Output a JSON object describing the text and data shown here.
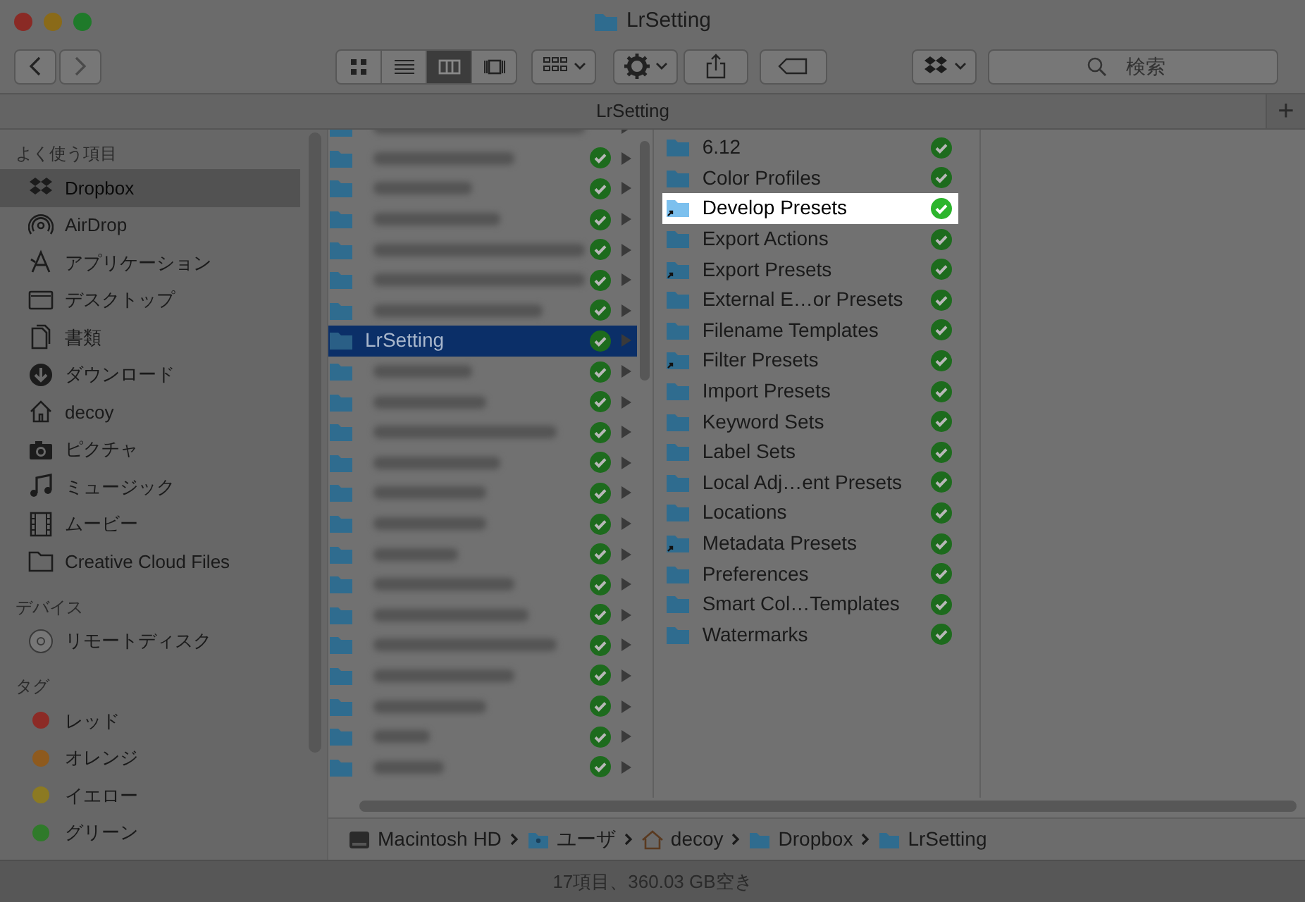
{
  "window": {
    "title": "LrSetting"
  },
  "toolbar": {
    "view_modes": [
      {
        "kind": "icons",
        "selected": false
      },
      {
        "kind": "list",
        "selected": false
      },
      {
        "kind": "columns",
        "selected": true
      },
      {
        "kind": "gallery",
        "selected": false
      }
    ],
    "search": {
      "placeholder": "検索"
    }
  },
  "tab_bar": {
    "tabs": [
      {
        "label": "LrSetting",
        "selected": true
      }
    ],
    "new_tab": "+"
  },
  "sidebar": {
    "sections": [
      {
        "title": "よく使う項目",
        "items": [
          {
            "label": "Dropbox",
            "kind": "dropbox",
            "selected": true
          },
          {
            "label": "AirDrop",
            "kind": "airdrop",
            "selected": false
          },
          {
            "label": "アプリケーション",
            "kind": "apps",
            "selected": false
          },
          {
            "label": "デスクトップ",
            "kind": "desktop",
            "selected": false
          },
          {
            "label": "書類",
            "kind": "documents",
            "selected": false
          },
          {
            "label": "ダウンロード",
            "kind": "downloads",
            "selected": false
          },
          {
            "label": "decoy",
            "kind": "home",
            "selected": false
          },
          {
            "label": "ピクチャ",
            "kind": "pictures",
            "selected": false
          },
          {
            "label": "ミュージック",
            "kind": "music",
            "selected": false
          },
          {
            "label": "ムービー",
            "kind": "movies",
            "selected": false
          },
          {
            "label": "Creative Cloud Files",
            "kind": "folder",
            "selected": false
          }
        ]
      },
      {
        "title": "デバイス",
        "items": [
          {
            "label": "リモートディスク",
            "kind": "disc",
            "selected": false
          }
        ]
      },
      {
        "title": "タグ",
        "items": [
          {
            "label": "レッド",
            "kind": "tag",
            "color": "#8c2b26",
            "selected": false
          },
          {
            "label": "オレンジ",
            "kind": "tag",
            "color": "#8e5a1e",
            "selected": false
          },
          {
            "label": "イエロー",
            "kind": "tag",
            "color": "#8c7a22",
            "selected": false
          },
          {
            "label": "グリーン",
            "kind": "tag",
            "color": "#2f7a2a",
            "selected": false
          }
        ]
      }
    ]
  },
  "columns": [
    {
      "rows": [
        {
          "kind": "blurred",
          "synced": false,
          "selected": false
        },
        {
          "kind": "blurred",
          "synced": true,
          "selected": false
        },
        {
          "kind": "blurred",
          "synced": true,
          "selected": false
        },
        {
          "kind": "blurred",
          "synced": true,
          "selected": false
        },
        {
          "kind": "blurred",
          "synced": true,
          "selected": false
        },
        {
          "kind": "blurred",
          "synced": true,
          "selected": false
        },
        {
          "kind": "blurred",
          "synced": true,
          "selected": false
        },
        {
          "kind": "folder",
          "label": "LrSetting",
          "synced": true,
          "selected": true
        },
        {
          "kind": "blurred",
          "synced": true,
          "selected": false
        },
        {
          "kind": "blurred",
          "synced": true,
          "selected": false
        },
        {
          "kind": "blurred",
          "synced": true,
          "selected": false
        },
        {
          "kind": "blurred",
          "synced": true,
          "selected": false
        },
        {
          "kind": "blurred",
          "synced": true,
          "selected": false
        },
        {
          "kind": "blurred",
          "synced": true,
          "selected": false
        },
        {
          "kind": "blurred",
          "synced": true,
          "selected": false
        },
        {
          "kind": "blurred",
          "synced": true,
          "selected": false
        },
        {
          "kind": "blurred",
          "synced": true,
          "selected": false
        },
        {
          "kind": "blurred",
          "synced": true,
          "selected": false
        },
        {
          "kind": "blurred",
          "synced": true,
          "selected": false
        },
        {
          "kind": "blurred",
          "synced": true,
          "selected": false
        },
        {
          "kind": "blurred",
          "synced": true,
          "selected": false
        },
        {
          "kind": "blurred",
          "synced": true,
          "selected": false
        }
      ]
    },
    {
      "rows": [
        {
          "kind": "folder",
          "label": "6.12",
          "alias": false,
          "highlighted": false
        },
        {
          "kind": "folder",
          "label": "Color Profiles",
          "alias": false,
          "highlighted": false
        },
        {
          "kind": "folder",
          "label": "Develop Presets",
          "alias": true,
          "highlighted": true
        },
        {
          "kind": "folder",
          "label": "Export Actions",
          "alias": false,
          "highlighted": false
        },
        {
          "kind": "folder",
          "label": "Export Presets",
          "alias": true,
          "highlighted": false
        },
        {
          "kind": "folder",
          "label": "External E…or Presets",
          "alias": false,
          "highlighted": false
        },
        {
          "kind": "folder",
          "label": "Filename Templates",
          "alias": false,
          "highlighted": false
        },
        {
          "kind": "folder",
          "label": "Filter Presets",
          "alias": true,
          "highlighted": false
        },
        {
          "kind": "folder",
          "label": "Import Presets",
          "alias": false,
          "highlighted": false
        },
        {
          "kind": "folder",
          "label": "Keyword Sets",
          "alias": false,
          "highlighted": false
        },
        {
          "kind": "folder",
          "label": "Label Sets",
          "alias": false,
          "highlighted": false
        },
        {
          "kind": "folder",
          "label": "Local Adj…ent Presets",
          "alias": false,
          "highlighted": false
        },
        {
          "kind": "folder",
          "label": "Locations",
          "alias": false,
          "highlighted": false
        },
        {
          "kind": "folder",
          "label": "Metadata Presets",
          "alias": true,
          "highlighted": false
        },
        {
          "kind": "folder",
          "label": "Preferences",
          "alias": false,
          "highlighted": false
        },
        {
          "kind": "folder",
          "label": "Smart Col…Templates",
          "alias": false,
          "highlighted": false
        },
        {
          "kind": "folder",
          "label": "Watermarks",
          "alias": false,
          "highlighted": false
        }
      ]
    }
  ],
  "path_bar": [
    {
      "label": "Macintosh HD",
      "kind": "disk"
    },
    {
      "label": "ユーザ",
      "kind": "users"
    },
    {
      "label": "decoy",
      "kind": "home"
    },
    {
      "label": "Dropbox",
      "kind": "dropbox"
    },
    {
      "label": "LrSetting",
      "kind": "folder"
    }
  ],
  "status_bar": "17項目、360.03 GB空き"
}
